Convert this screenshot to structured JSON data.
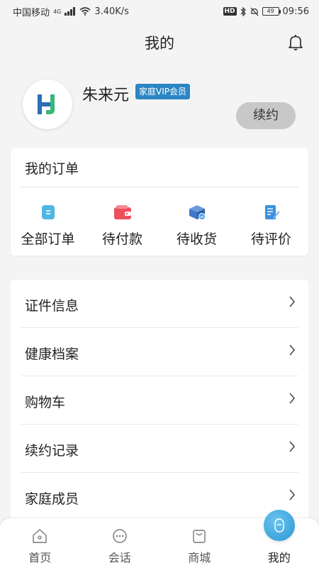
{
  "status_bar": {
    "carrier": "中国移动",
    "network": "4G",
    "speed": "3.40K/s",
    "hd": "HD",
    "battery": "49",
    "time": "09:56"
  },
  "header": {
    "title": "我的",
    "bell_icon": "bell-icon"
  },
  "profile": {
    "name": "朱来元",
    "badge": "家庭VIP会员",
    "renew_label": "续约"
  },
  "orders": {
    "title": "我的订单",
    "items": [
      {
        "label": "全部订单",
        "icon": "all-orders-icon",
        "color": "#4fb6e6"
      },
      {
        "label": "待付款",
        "icon": "wallet-icon",
        "color": "#ee4f5e"
      },
      {
        "label": "待收货",
        "icon": "package-icon",
        "color": "#3f78c9"
      },
      {
        "label": "待评价",
        "icon": "review-icon",
        "color": "#3f8fe0"
      }
    ]
  },
  "menu": {
    "items": [
      {
        "label": "证件信息"
      },
      {
        "label": "健康档案"
      },
      {
        "label": "购物车"
      },
      {
        "label": "续约记录"
      },
      {
        "label": "家庭成员"
      }
    ]
  },
  "bottom_nav": {
    "items": [
      {
        "label": "首页",
        "icon": "home-icon"
      },
      {
        "label": "会话",
        "icon": "chat-icon"
      },
      {
        "label": "商城",
        "icon": "shop-bag-icon"
      },
      {
        "label": "我的",
        "icon": "profile-icon",
        "active": true
      }
    ]
  },
  "colors": {
    "accent": "#2c86c4",
    "background": "#f4f4f4"
  }
}
